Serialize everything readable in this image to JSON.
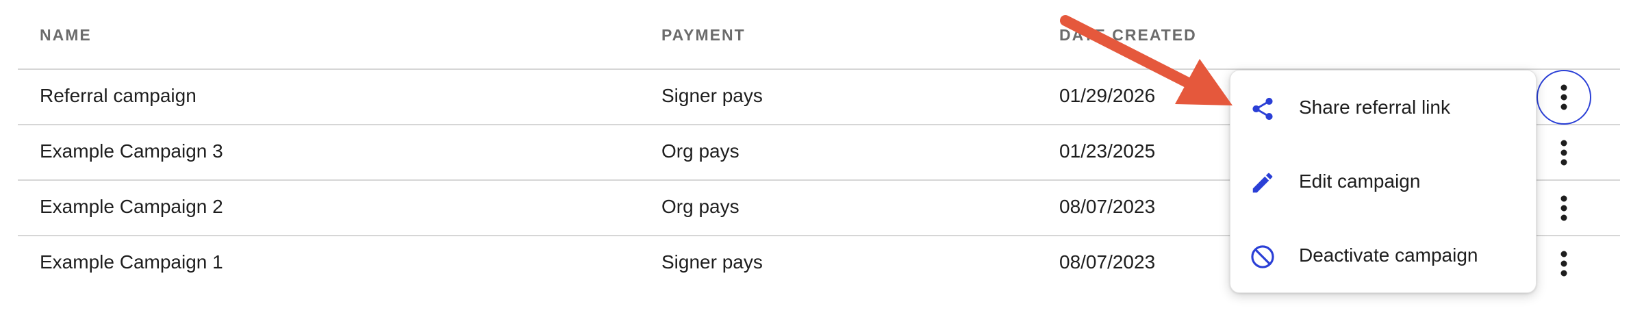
{
  "table": {
    "headers": {
      "name": "NAME",
      "payment": "PAYMENT",
      "date_created": "DATE CREATED"
    },
    "rows": [
      {
        "name": "Referral campaign",
        "payment": "Signer pays",
        "date_created": "01/29/2026"
      },
      {
        "name": "Example Campaign 3",
        "payment": "Org pays",
        "date_created": "01/23/2025"
      },
      {
        "name": "Example Campaign 2",
        "payment": "Org pays",
        "date_created": "08/07/2023"
      },
      {
        "name": "Example Campaign 1",
        "payment": "Signer pays",
        "date_created": "08/07/2023"
      }
    ],
    "row_action_icon": "more-vertical-icon"
  },
  "menu": {
    "items": [
      {
        "label": "Share referral link",
        "icon": "share-icon"
      },
      {
        "label": "Edit campaign",
        "icon": "pencil-icon"
      },
      {
        "label": "Deactivate campaign",
        "icon": "block-icon"
      }
    ]
  },
  "annotation": {
    "icon": "arrow-icon"
  },
  "colors": {
    "accent": "#2a3fd6",
    "annotation_arrow": "#e5583c",
    "header_text": "#6b6b6b",
    "divider": "#d6d6d6"
  }
}
